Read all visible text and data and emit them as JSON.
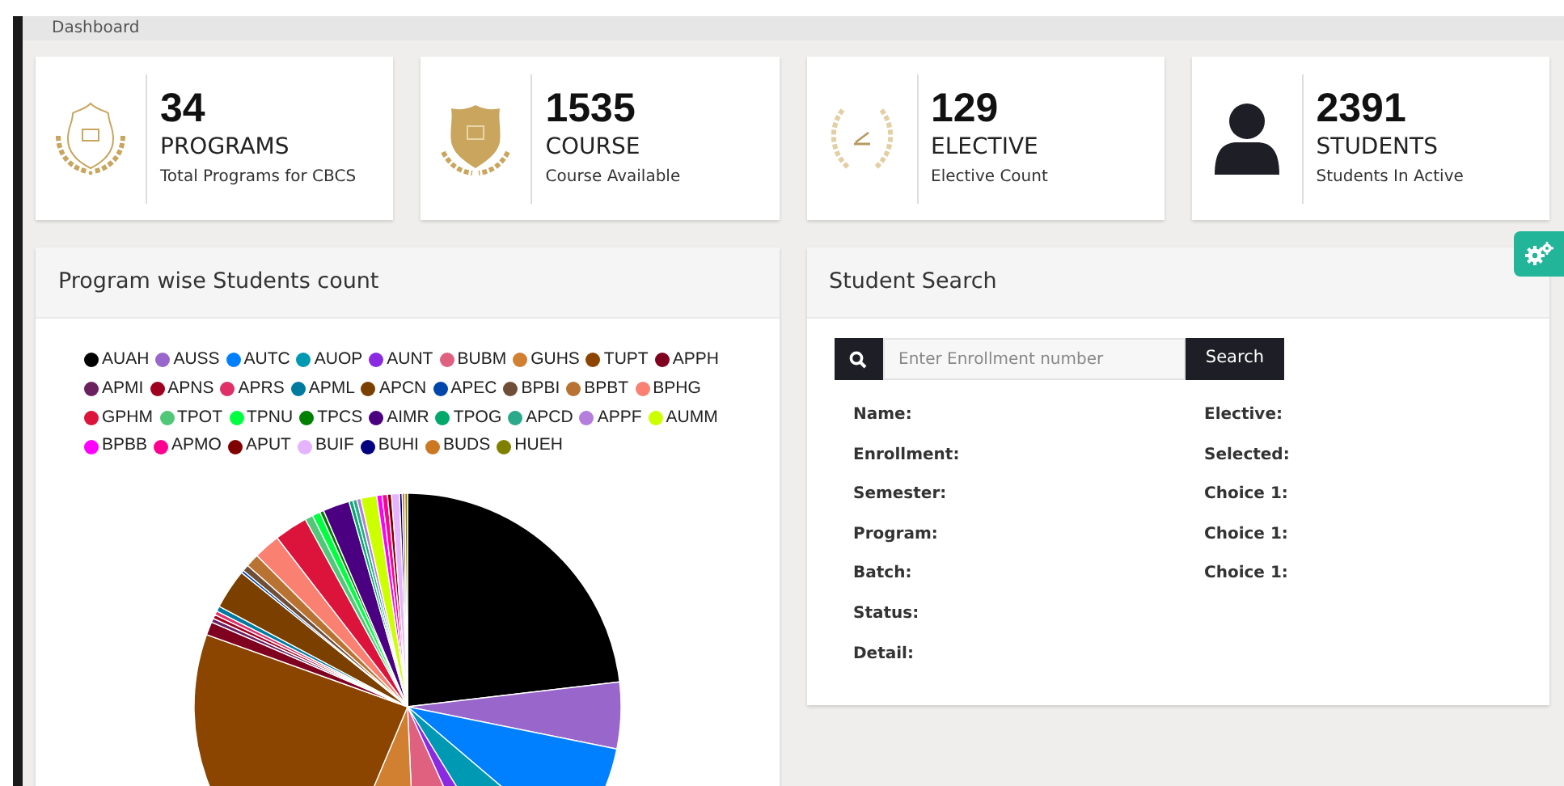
{
  "breadcrumb": "Dashboard",
  "stats": [
    {
      "kind": "emblem",
      "value": "34",
      "title": "PROGRAMS",
      "subtitle": "Total Programs for CBCS"
    },
    {
      "kind": "shield",
      "value": "1535",
      "title": "COURSE",
      "subtitle": "Course Available"
    },
    {
      "kind": "wreath",
      "value": "129",
      "title": "ELECTIVE",
      "subtitle": "Elective Count"
    },
    {
      "kind": "user",
      "value": "2391",
      "title": "STUDENTS",
      "subtitle": "Students In Active"
    }
  ],
  "chart_panel": {
    "title": "Program wise Students count",
    "legend": [
      {
        "label": "AUAH",
        "color": "#000000"
      },
      {
        "label": "AUSS",
        "color": "#9966cc"
      },
      {
        "label": "AUTC",
        "color": "#0080ff"
      },
      {
        "label": "AUOP",
        "color": "#0099b3"
      },
      {
        "label": "AUNT",
        "color": "#8a2be2"
      },
      {
        "label": "BUBM",
        "color": "#e06080"
      },
      {
        "label": "GUHS",
        "color": "#d08030"
      },
      {
        "label": "TUPT",
        "color": "#8b4500"
      },
      {
        "label": "APPH",
        "color": "#800020"
      },
      {
        "label": "APMI",
        "color": "#6b2060"
      },
      {
        "label": "APNS",
        "color": "#a00020"
      },
      {
        "label": "APRS",
        "color": "#e0306a"
      },
      {
        "label": "APML",
        "color": "#007ba0"
      },
      {
        "label": "APCN",
        "color": "#7b3f00"
      },
      {
        "label": "APEC",
        "color": "#0047ab"
      },
      {
        "label": "BPBI",
        "color": "#6f4e37"
      },
      {
        "label": "BPBT",
        "color": "#b87333"
      },
      {
        "label": "BPHG",
        "color": "#fa8072"
      },
      {
        "label": "GPHM",
        "color": "#dc143c"
      },
      {
        "label": "TPOT",
        "color": "#50c878"
      },
      {
        "label": "TPNU",
        "color": "#00ff40"
      },
      {
        "label": "TPCS",
        "color": "#008000"
      },
      {
        "label": "AIMR",
        "color": "#4b0082"
      },
      {
        "label": "TPOG",
        "color": "#00a86b"
      },
      {
        "label": "APCD",
        "color": "#2aaa8a"
      },
      {
        "label": "APPF",
        "color": "#b57edc"
      },
      {
        "label": "AUMM",
        "color": "#ccff00"
      },
      {
        "label": "BPBB",
        "color": "#ff00ff"
      },
      {
        "label": "APMO",
        "color": "#ff0090"
      },
      {
        "label": "APUT",
        "color": "#800000"
      },
      {
        "label": "BUIF",
        "color": "#e6b3ff"
      },
      {
        "label": "BUHI",
        "color": "#000080"
      },
      {
        "label": "BUDS",
        "color": "#cc7722"
      },
      {
        "label": "HUEH",
        "color": "#808000"
      }
    ]
  },
  "search_panel": {
    "title": "Student Search",
    "placeholder": "Enter Enrollment number",
    "button": "Search",
    "left_fields": [
      "Name:",
      "Enrollment:",
      "Semester:",
      "Program:",
      "Batch:",
      "Status:",
      "Detail:"
    ],
    "right_fields": [
      "Elective:",
      "Selected:",
      "Choice 1:",
      "Choice 1:",
      "Choice 1:"
    ]
  }
}
